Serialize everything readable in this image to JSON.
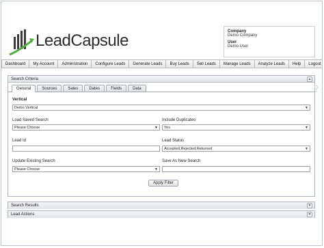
{
  "brand": {
    "lead": "Lead",
    "capsule": "Capsule",
    "bar_color": "#3a3a3a",
    "arrow_color": "#4caf3a"
  },
  "account": {
    "company_label": "Company",
    "company_value": "Demo Company",
    "user_label": "User",
    "user_value": "Demo User"
  },
  "nav": {
    "items": [
      "Dashboard",
      "My Account",
      "Administration",
      "Configure Leads",
      "Generate Leads",
      "Buy Leads",
      "Sell Leads",
      "Manage Leads",
      "Analyze Leads",
      "Help",
      "Logout"
    ]
  },
  "search_criteria": {
    "title": "Search Criteria",
    "tabs": [
      "General",
      "Sources",
      "Sales",
      "Dates",
      "Fields",
      "Data"
    ],
    "active_tab": "General",
    "help_icon": "help-icon",
    "vertical": {
      "label": "Vertical",
      "value": "Demo Vertical"
    },
    "load_saved_search": {
      "label": "Load Saved Search",
      "value": "Please Choose"
    },
    "include_duplicates": {
      "label": "Include Duplicates",
      "value": "Yes"
    },
    "lead_id": {
      "label": "Lead Id",
      "value": ""
    },
    "lead_status": {
      "label": "Lead Status",
      "value": "Accepted,Rejected,Returned"
    },
    "update_existing_search": {
      "label": "Update Existing Search",
      "value": "Please Choose"
    },
    "save_as_new_search": {
      "label": "Save As New Search",
      "value": ""
    },
    "apply_filter": "Apply Filter"
  },
  "search_results": {
    "title": "Search Results"
  },
  "lead_actions": {
    "title": "Lead Actions"
  }
}
